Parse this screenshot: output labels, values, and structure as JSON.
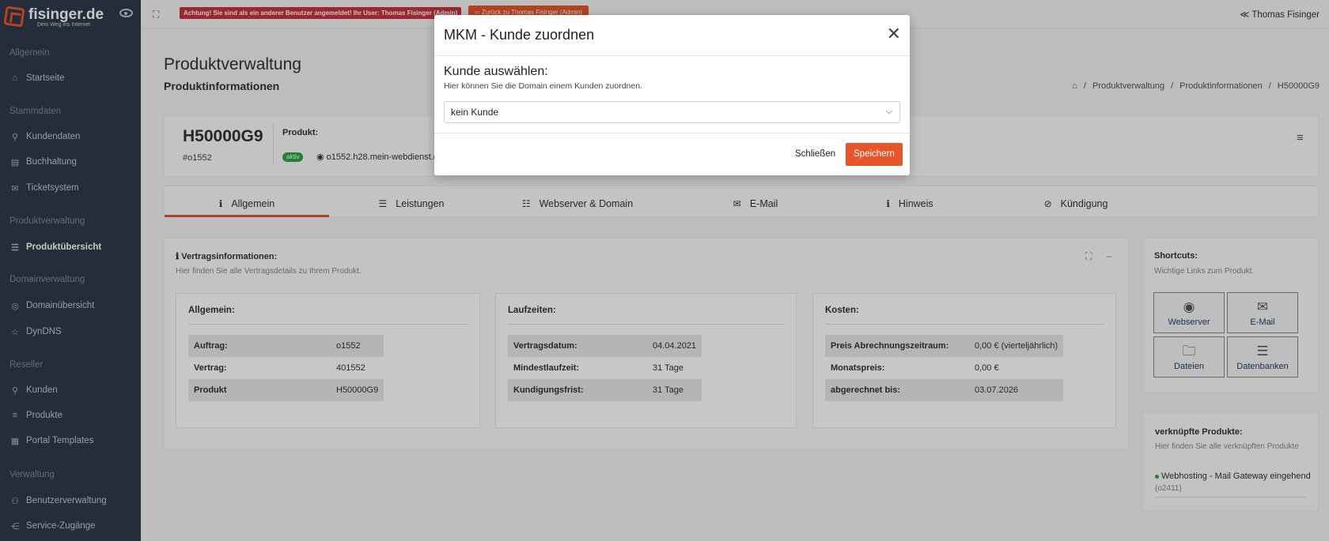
{
  "brand": {
    "name": "fisinger.de",
    "slogan": "Dein Weg ins Internet"
  },
  "sidebar": {
    "sections": [
      {
        "title": "Allgemein",
        "items": [
          {
            "label": "Startseite",
            "icon": "home-icon"
          }
        ]
      },
      {
        "title": "Stammdaten",
        "items": [
          {
            "label": "Kundendaten",
            "icon": "user-icon"
          },
          {
            "label": "Buchhaltung",
            "icon": "document-icon"
          },
          {
            "label": "Ticketsystem",
            "icon": "mail-icon"
          }
        ]
      },
      {
        "title": "Produktverwaltung",
        "items": [
          {
            "label": "Produktübersicht",
            "icon": "server-icon"
          }
        ]
      },
      {
        "title": "Domainverwaltung",
        "items": [
          {
            "label": "Domainübersicht",
            "icon": "globe-icon"
          },
          {
            "label": "DynDNS",
            "icon": "star-icon"
          }
        ]
      },
      {
        "title": "Reseller",
        "items": [
          {
            "label": "Kunden",
            "icon": "user-icon"
          },
          {
            "label": "Produkte",
            "icon": "list-icon"
          },
          {
            "label": "Portal Templates",
            "icon": "layout-icon"
          }
        ]
      },
      {
        "title": "Verwaltung",
        "items": [
          {
            "label": "Benutzerverwaltung",
            "icon": "users-icon"
          },
          {
            "label": "Service-Zugänge",
            "icon": "share-icon"
          }
        ]
      }
    ]
  },
  "topbar": {
    "alert": "Achtung! Sie sind als ein anderer Benutzer angemeldet! Ihr User: Thomas Fisinger (Admin)",
    "back_label": "Zurück zu Thomas Fisinger (Admin)",
    "user": "Thomas Fisinger"
  },
  "page": {
    "title": "Produktverwaltung",
    "subtitle": "Produktinformationen",
    "breadcrumbs": [
      "Produktverwaltung",
      "Produktinformationen",
      "H50000G9"
    ]
  },
  "product": {
    "code": "H50000G9",
    "id": "#o1552",
    "label": "Produkt:",
    "status": "aktiv",
    "host": "o1552.h28.mein-webdienst.de"
  },
  "tabs": [
    {
      "label": "Allgemein",
      "icon": "info-icon"
    },
    {
      "label": "Leistungen",
      "icon": "list-icon"
    },
    {
      "label": "Webserver & Domain",
      "icon": "server-icon"
    },
    {
      "label": "E-Mail",
      "icon": "envelope-icon"
    },
    {
      "label": "Hinweis",
      "icon": "info-icon"
    },
    {
      "label": "Kündigung",
      "icon": "ban-icon"
    }
  ],
  "contract": {
    "title": "Vertragsinformationen:",
    "subtitle": "Hier finden Sie alle Vertragsdetails zu Ihrem Produkt.",
    "boxes": [
      {
        "title": "Allgemein:",
        "rows": [
          [
            "Auftrag:",
            "o1552"
          ],
          [
            "Vertrag:",
            "401552"
          ],
          [
            "Produkt",
            "H50000G9"
          ]
        ]
      },
      {
        "title": "Laufzeiten:",
        "rows": [
          [
            "Vertragsdatum:",
            "04.04.2021"
          ],
          [
            "Mindestlaufzeit:",
            "31 Tage"
          ],
          [
            "Kundigungsfrist:",
            "31 Tage"
          ]
        ]
      },
      {
        "title": "Kosten:",
        "rows": [
          [
            "Preis Abrechnungszeitraum:",
            "0,00 € (vierteljährlich)"
          ],
          [
            "Monatspreis:",
            "0,00 €"
          ],
          [
            "abgerechnet bis:",
            "03.07.2026"
          ]
        ]
      }
    ]
  },
  "shortcuts": {
    "title": "Shortcuts:",
    "subtitle": "Wichtige Links zum Produkt.",
    "items": [
      {
        "label": "Webserver",
        "icon": "globe-icon"
      },
      {
        "label": "E-Mail",
        "icon": "envelope-icon"
      },
      {
        "label": "Dateien",
        "icon": "folder-icon"
      },
      {
        "label": "Datenbanken",
        "icon": "database-icon"
      }
    ]
  },
  "linked": {
    "title": "verknüpfte Produkte:",
    "subtitle": "Hier finden Sie alle verknüpften Produkte",
    "items": [
      {
        "label": "Webhosting - Mail Gateway eingehend",
        "code": "(o2411)"
      }
    ]
  },
  "modal": {
    "title": "MKM - Kunde zuordnen",
    "heading": "Kunde auswählen:",
    "subtitle": "Hier können Sie die Domain einem Kunden zuordnen.",
    "select_value": "kein Kunde",
    "cancel_label": "Schließen",
    "save_label": "Speichern"
  },
  "colors": {
    "accent": "#e8552a",
    "sidebar": "#2f3a4b",
    "success": "#28a745",
    "danger": "#c8323c"
  }
}
